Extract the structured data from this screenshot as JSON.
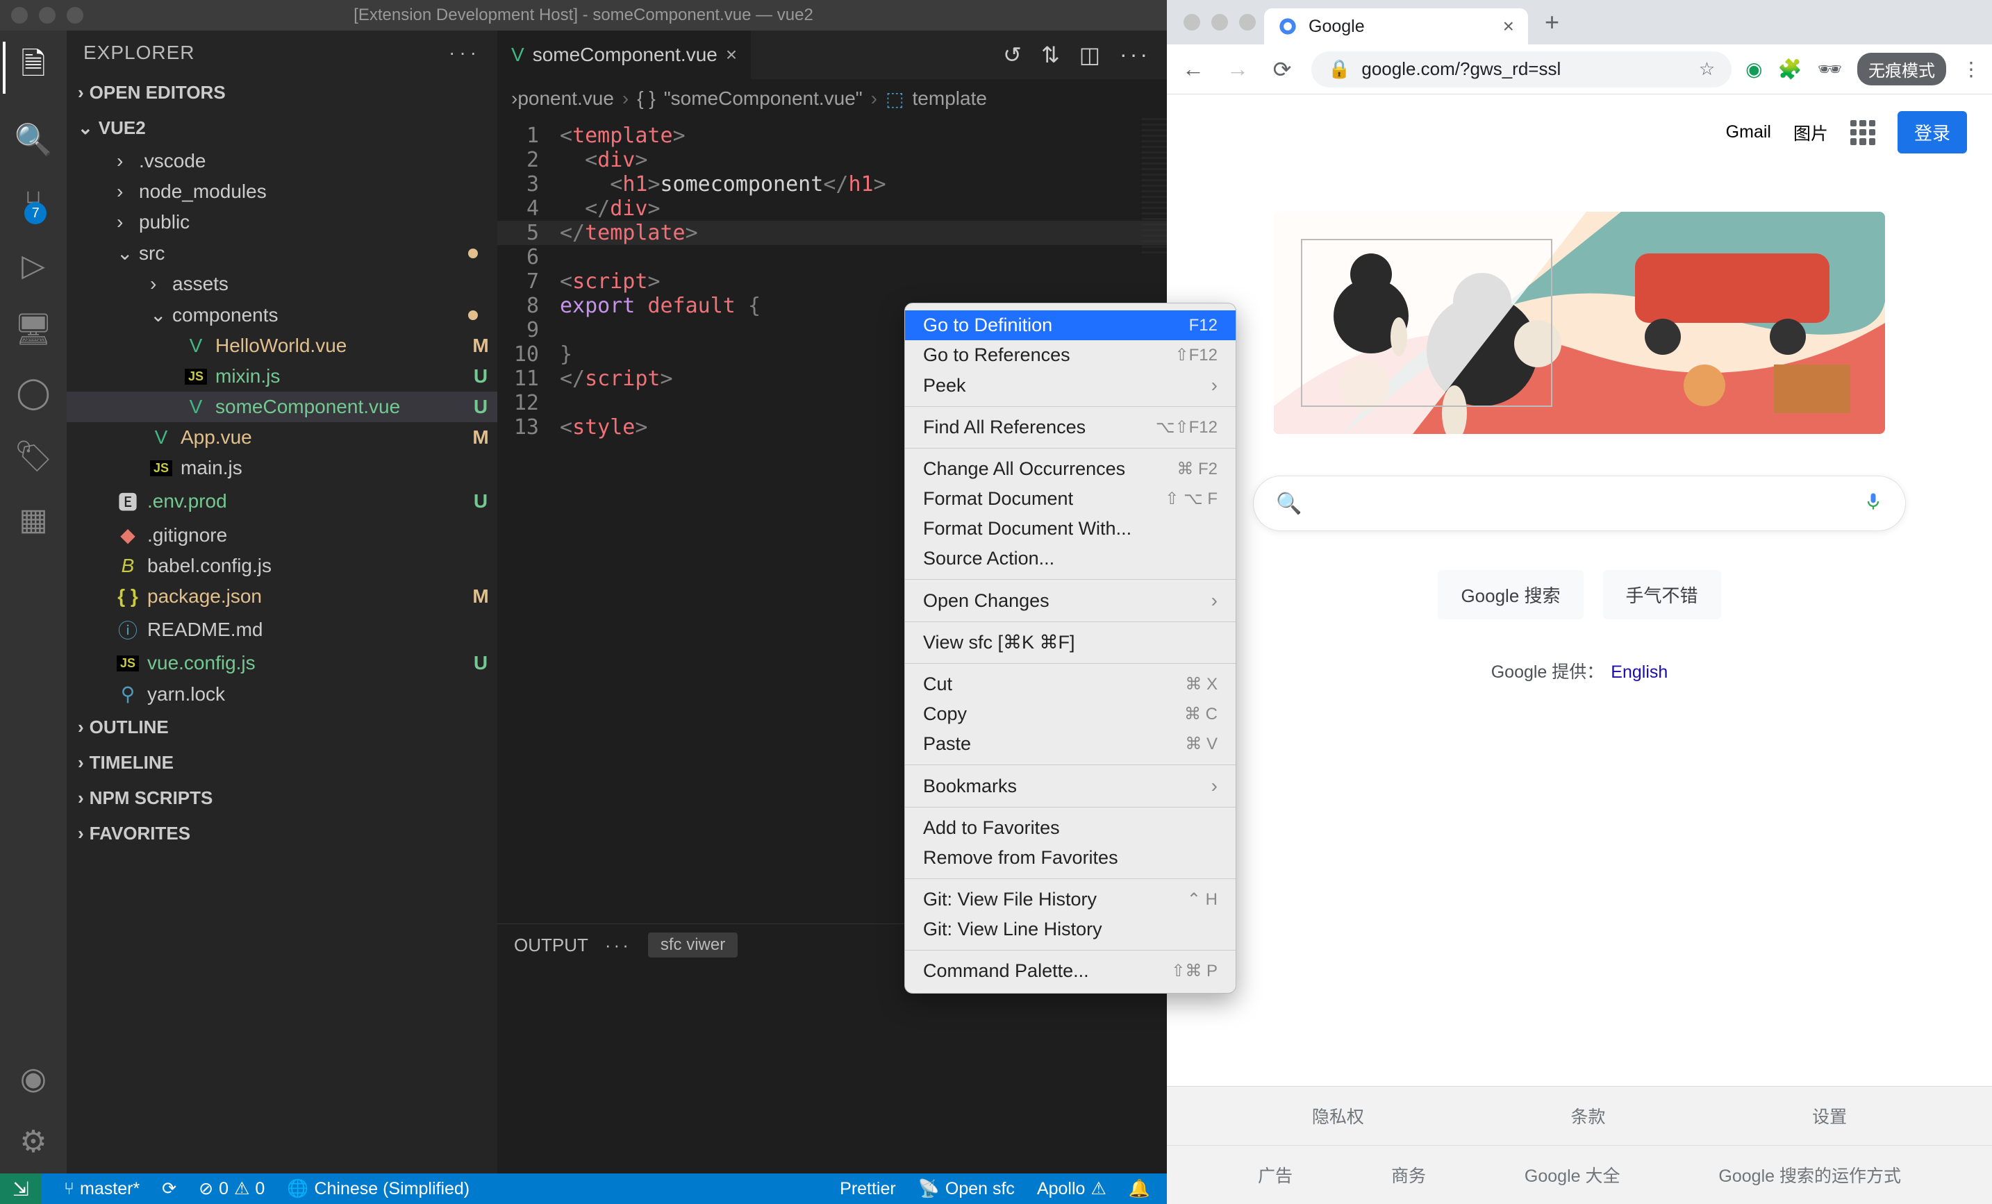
{
  "vscode": {
    "window_title": "[Extension Development Host] - someComponent.vue — vue2",
    "explorer_label": "EXPLORER",
    "scm_badge": "7",
    "sections": {
      "open_editors": "OPEN EDITORS",
      "project": "VUE2",
      "outline": "OUTLINE",
      "timeline": "TIMELINE",
      "npm_scripts": "NPM SCRIPTS",
      "favorites": "FAVORITES"
    },
    "tree": {
      "vscode_dir": ".vscode",
      "node_modules": "node_modules",
      "public": "public",
      "src": "src",
      "assets": "assets",
      "components": "components",
      "helloworld": "HelloWorld.vue",
      "mixin": "mixin.js",
      "somecomp": "someComponent.vue",
      "app": "App.vue",
      "main": "main.js",
      "envprod": ".env.prod",
      "gitignore": ".gitignore",
      "babel": "babel.config.js",
      "package": "package.json",
      "readme": "README.md",
      "vueconfig": "vue.config.js",
      "yarn": "yarn.lock"
    },
    "status_M": "M",
    "status_U": "U",
    "tab": {
      "name": "someComponent.vue"
    },
    "breadcrumb": {
      "part1": "›ponent.vue",
      "part2": "{ }",
      "part3": "\"someComponent.vue\"",
      "part4": "template"
    },
    "code": {
      "l1": {
        "n": "1"
      },
      "l2": {
        "n": "2"
      },
      "l3": {
        "n": "3",
        "text": "somecomponent"
      },
      "l4": {
        "n": "4"
      },
      "l5": {
        "n": "5"
      },
      "l6": {
        "n": "6"
      },
      "l7": {
        "n": "7"
      },
      "l8": {
        "n": "8",
        "exp": "export",
        "def": "default",
        "brace": "{"
      },
      "l9": {
        "n": "9"
      },
      "l10": {
        "n": "10",
        "brace": "}"
      },
      "l11": {
        "n": "11"
      },
      "l12": {
        "n": "12"
      },
      "l13": {
        "n": "13"
      },
      "template": "template",
      "div": "div",
      "h1": "h1",
      "script": "script",
      "style": "style"
    },
    "panel": {
      "output": "OUTPUT",
      "dropdown": "sfc viwer"
    },
    "status": {
      "branch": "master*",
      "errors": "0",
      "warnings": "0",
      "lang": "Chinese (Simplified)",
      "prettier": "Prettier",
      "opensfc": "Open sfc",
      "apollo": "Apollo"
    }
  },
  "context_menu": {
    "go_def": "Go to Definition",
    "go_def_sc": "F12",
    "go_ref": "Go to References",
    "go_ref_sc": "⇧F12",
    "peek": "Peek",
    "find_ref": "Find All References",
    "find_ref_sc": "⌥⇧F12",
    "change_occ": "Change All Occurrences",
    "change_occ_sc": "⌘ F2",
    "fmt_doc": "Format Document",
    "fmt_doc_sc": "⇧ ⌥ F",
    "fmt_with": "Format Document With...",
    "src_action": "Source Action...",
    "open_changes": "Open Changes",
    "view_sfc": "View sfc [⌘K ⌘F]",
    "cut": "Cut",
    "cut_sc": "⌘ X",
    "copy": "Copy",
    "copy_sc": "⌘ C",
    "paste": "Paste",
    "paste_sc": "⌘ V",
    "bookmarks": "Bookmarks",
    "add_fav": "Add to Favorites",
    "rem_fav": "Remove from Favorites",
    "git_file": "Git: View File History",
    "git_file_sc": "⌃ H",
    "git_line": "Git: View Line History",
    "cmd_pal": "Command Palette...",
    "cmd_pal_sc": "⇧⌘ P"
  },
  "chrome": {
    "tab_title": "Google",
    "url": "google.com/?gws_rd=ssl",
    "incognito": "无痕模式",
    "gmail": "Gmail",
    "images": "图片",
    "signin": "登录",
    "search_placeholder": "",
    "btn_search": "Google 搜索",
    "btn_lucky": "手气不错",
    "lang_prefix": "Google 提供：",
    "lang_link": "English",
    "footer1": {
      "a": "隐私权",
      "b": "条款",
      "c": "设置"
    },
    "footer2": {
      "a": "广告",
      "b": "商务",
      "c": "Google 大全",
      "d": "Google 搜索的运作方式"
    }
  }
}
